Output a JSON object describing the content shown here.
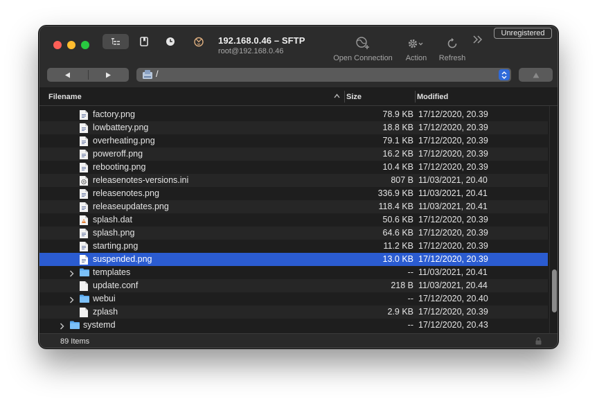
{
  "window": {
    "title": "192.168.0.46 – SFTP",
    "subtitle": "root@192.168.0.46",
    "unregistered_label": "Unregistered"
  },
  "toolbar": {
    "open_connection_label": "Open Connection",
    "action_label": "Action",
    "refresh_label": "Refresh"
  },
  "path": {
    "value": "/"
  },
  "columns": {
    "filename": "Filename",
    "size": "Size",
    "modified": "Modified"
  },
  "files": [
    {
      "name": "factory.png",
      "size": "78.9 KB",
      "modified": "17/12/2020, 20.39",
      "kind": "image",
      "indent": 1
    },
    {
      "name": "lowbattery.png",
      "size": "18.8 KB",
      "modified": "17/12/2020, 20.39",
      "kind": "image",
      "indent": 1
    },
    {
      "name": "overheating.png",
      "size": "79.1 KB",
      "modified": "17/12/2020, 20.39",
      "kind": "image",
      "indent": 1
    },
    {
      "name": "poweroff.png",
      "size": "16.2 KB",
      "modified": "17/12/2020, 20.39",
      "kind": "image",
      "indent": 1
    },
    {
      "name": "rebooting.png",
      "size": "10.4 KB",
      "modified": "17/12/2020, 20.39",
      "kind": "image",
      "indent": 1
    },
    {
      "name": "releasenotes-versions.ini",
      "size": "807 B",
      "modified": "11/03/2021, 20.40",
      "kind": "config",
      "indent": 1
    },
    {
      "name": "releasenotes.png",
      "size": "336.9 KB",
      "modified": "11/03/2021, 20.41",
      "kind": "image",
      "indent": 1
    },
    {
      "name": "releaseupdates.png",
      "size": "118.4 KB",
      "modified": "11/03/2021, 20.41",
      "kind": "image",
      "indent": 1
    },
    {
      "name": "splash.dat",
      "size": "50.6 KB",
      "modified": "17/12/2020, 20.39",
      "kind": "data",
      "indent": 1
    },
    {
      "name": "splash.png",
      "size": "64.6 KB",
      "modified": "17/12/2020, 20.39",
      "kind": "image",
      "indent": 1
    },
    {
      "name": "starting.png",
      "size": "11.2 KB",
      "modified": "17/12/2020, 20.39",
      "kind": "image",
      "indent": 1
    },
    {
      "name": "suspended.png",
      "size": "13.0 KB",
      "modified": "17/12/2020, 20.39",
      "kind": "image",
      "indent": 1,
      "selected": true
    },
    {
      "name": "templates",
      "size": "--",
      "modified": "11/03/2021, 20.41",
      "kind": "folder",
      "indent": 1
    },
    {
      "name": "update.conf",
      "size": "218 B",
      "modified": "11/03/2021, 20.44",
      "kind": "blank",
      "indent": 1
    },
    {
      "name": "webui",
      "size": "--",
      "modified": "17/12/2020, 20.40",
      "kind": "folder",
      "indent": 1
    },
    {
      "name": "zplash",
      "size": "2.9 KB",
      "modified": "17/12/2020, 20.39",
      "kind": "blank",
      "indent": 1
    },
    {
      "name": "systemd",
      "size": "--",
      "modified": "17/12/2020, 20.43",
      "kind": "folder",
      "indent": 0
    }
  ],
  "footer": {
    "item_count": "89 Items"
  },
  "colors": {
    "accent": "#2b5cd1",
    "folder": "#5aaaf0",
    "window_bg": "#1e1e1e"
  }
}
